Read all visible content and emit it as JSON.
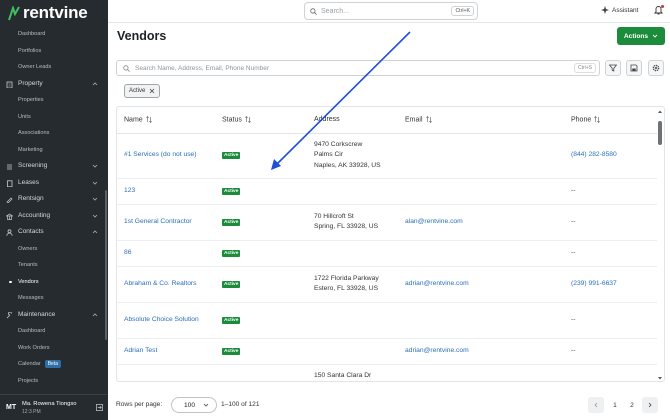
{
  "app": {
    "brand": "rentvine"
  },
  "sidebar": {
    "sections": [
      {
        "type": "sub",
        "label": "Dashboard"
      },
      {
        "type": "sub",
        "label": "Portfolios"
      },
      {
        "type": "sub",
        "label": "Owner Leads"
      },
      {
        "type": "section",
        "label": "Property",
        "icon": "building-icon",
        "expanded": true
      },
      {
        "type": "sub",
        "label": "Properties"
      },
      {
        "type": "sub",
        "label": "Units"
      },
      {
        "type": "sub",
        "label": "Associations"
      },
      {
        "type": "sub",
        "label": "Marketing"
      },
      {
        "type": "section",
        "label": "Screening",
        "icon": "list-icon",
        "expanded": false
      },
      {
        "type": "section",
        "label": "Leases",
        "icon": "document-icon",
        "expanded": false
      },
      {
        "type": "section",
        "label": "Rentsign",
        "icon": "pen-icon",
        "expanded": false
      },
      {
        "type": "section",
        "label": "Accounting",
        "icon": "bank-icon",
        "expanded": false
      },
      {
        "type": "section",
        "label": "Contacts",
        "icon": "user-icon",
        "expanded": true
      },
      {
        "type": "sub",
        "label": "Owners"
      },
      {
        "type": "sub",
        "label": "Tenants"
      },
      {
        "type": "sub",
        "label": "Vendors",
        "active": true
      },
      {
        "type": "sub",
        "label": "Messages"
      },
      {
        "type": "section",
        "label": "Maintenance",
        "icon": "wrench-icon",
        "expanded": true
      },
      {
        "type": "sub",
        "label": "Dashboard"
      },
      {
        "type": "sub",
        "label": "Work Orders"
      },
      {
        "type": "sub",
        "label": "Calendar",
        "badge": "Beta"
      },
      {
        "type": "sub",
        "label": "Projects"
      }
    ],
    "user": {
      "initials": "MT",
      "name": "Ma. Rowena Tiongso",
      "time": "12:3 PM"
    }
  },
  "topbar": {
    "search_placeholder": "Search...",
    "search_shortcut": "Ctrl+K",
    "assistant_label": "Assistant"
  },
  "page": {
    "title": "Vendors",
    "actions_label": "Actions",
    "search_placeholder": "Search Name, Address, Email, Phone Number",
    "search_shortcut": "Ctrl+S",
    "filter_chip": "Active"
  },
  "table": {
    "columns": [
      "Name",
      "Status",
      "Address",
      "Email",
      "Phone"
    ],
    "rows": [
      {
        "name": "#1 Services (do not use)",
        "status": "Active",
        "address": [
          "9470 Corkscrew",
          "Palms Cir",
          "Naples, AK 33928, US"
        ],
        "email": "",
        "phone": "(844) 282-8580"
      },
      {
        "name": "123",
        "status": "Active",
        "address": [],
        "email": "",
        "phone": "--"
      },
      {
        "name": "1st General Contractor",
        "status": "Active",
        "address": [
          "70 Hillcroft St",
          "Spring, FL 33928, US"
        ],
        "email": "alan@rentvine.com",
        "phone": "--"
      },
      {
        "name": "86",
        "status": "Active",
        "address": [],
        "email": "",
        "phone": "--"
      },
      {
        "name": "Abraham & Co. Realtors",
        "status": "Active",
        "address": [
          "1722 Florida Parkway",
          "Estero, FL 33928, US"
        ],
        "email": "adrian@rentvine.com",
        "phone": "(239) 991-6637"
      },
      {
        "name": "Absolute Choice Solution",
        "status": "Active",
        "address": [],
        "email": "",
        "phone": "--"
      },
      {
        "name": "Adrian Test",
        "status": "Active",
        "address": [],
        "email": "adrian@rentvine.com",
        "phone": "--"
      },
      {
        "name": "",
        "status": "",
        "address": [
          "150 Santa Clara Dr"
        ],
        "email": "",
        "phone": ""
      }
    ]
  },
  "footer": {
    "rows_per_page_label": "Rows per page:",
    "rows_per_page_value": "100",
    "range": "1–100 of 121",
    "pages": [
      "1",
      "2"
    ]
  }
}
